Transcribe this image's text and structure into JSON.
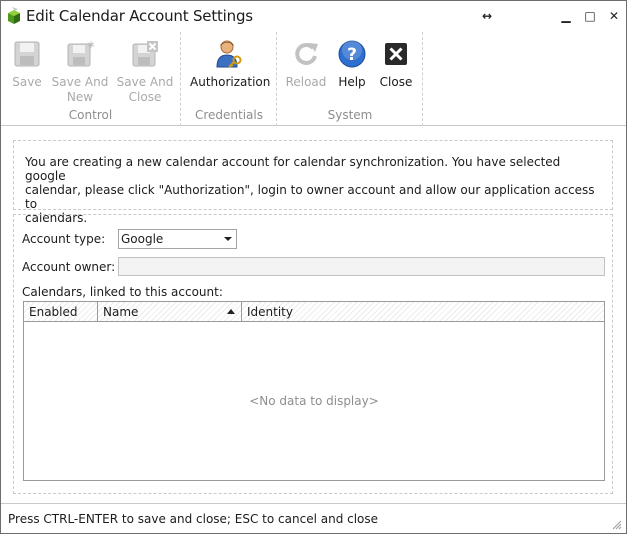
{
  "window": {
    "title": "Edit Calendar Account Settings",
    "resize_icon": "↔",
    "minimize": "▁",
    "maximize": "□",
    "close": "✕"
  },
  "ribbon": {
    "groups": [
      {
        "label": "Control",
        "buttons": [
          {
            "label": "Save",
            "icon": "save-icon",
            "enabled": false
          },
          {
            "label": "Save And New",
            "icon": "save-and-new-icon",
            "enabled": false
          },
          {
            "label": "Save And Close",
            "icon": "save-and-close-icon",
            "enabled": false
          }
        ]
      },
      {
        "label": "Credentials",
        "buttons": [
          {
            "label": "Authorization",
            "icon": "user-key-icon",
            "enabled": true
          }
        ]
      },
      {
        "label": "System",
        "buttons": [
          {
            "label": "Reload",
            "icon": "reload-icon",
            "enabled": false
          },
          {
            "label": "Help",
            "icon": "help-icon",
            "enabled": true
          },
          {
            "label": "Close",
            "icon": "close-icon",
            "enabled": true
          }
        ]
      }
    ]
  },
  "info": {
    "line1": "You are creating a new calendar account for calendar synchronization. You have selected google",
    "line2": "calendar, please click \"Authorization\", login to owner account and allow our application access to",
    "line3": "calendars."
  },
  "form": {
    "account_type_label": "Account type:",
    "account_type_value": "Google",
    "account_owner_label": "Account owner:",
    "account_owner_value": "",
    "calendars_label": "Calendars, linked to this account:"
  },
  "grid": {
    "columns": [
      "Enabled",
      "Name",
      "Identity"
    ],
    "empty_text": "<No data to display>"
  },
  "status": {
    "text": "Press CTRL-ENTER to save and close; ESC to cancel and close"
  },
  "colors": {
    "help_blue": "#2f6fd0",
    "disabled": "#a9a9a9",
    "group_label": "#8e8e8e"
  }
}
